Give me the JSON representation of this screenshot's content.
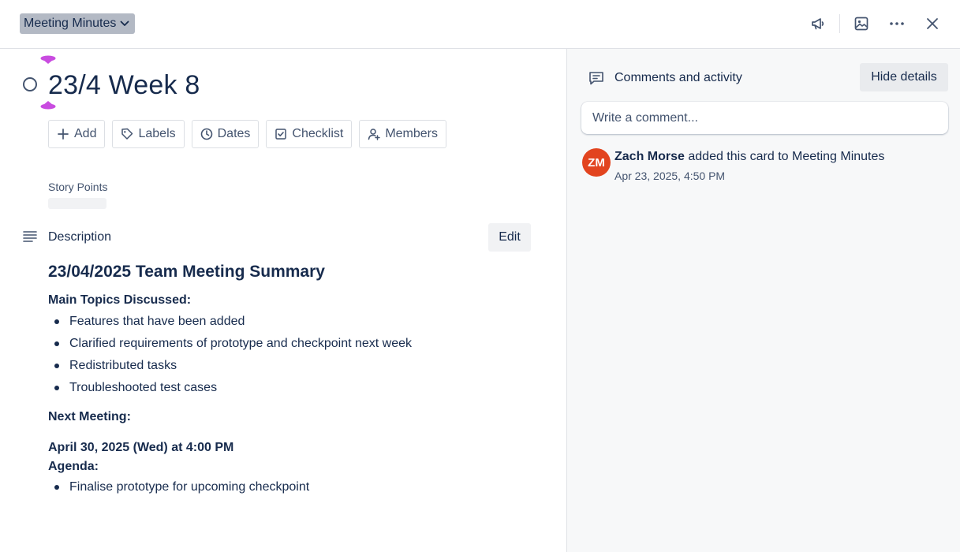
{
  "header": {
    "list_name": "Meeting Minutes",
    "icons": [
      "megaphone-icon",
      "cover-image-icon",
      "more-icon",
      "close-icon"
    ]
  },
  "card": {
    "title": "23/4 Week 8",
    "actions": [
      {
        "label": "Add",
        "icon": "plus-icon"
      },
      {
        "label": "Labels",
        "icon": "label-icon"
      },
      {
        "label": "Dates",
        "icon": "clock-icon"
      },
      {
        "label": "Checklist",
        "icon": "checklist-icon"
      },
      {
        "label": "Members",
        "icon": "add-member-icon"
      }
    ],
    "story_points_label": "Story Points",
    "description_label": "Description",
    "edit_label": "Edit"
  },
  "description": {
    "heading": "23/04/2025 Team Meeting Summary",
    "topics_label": "Main Topics Discussed:",
    "topics": [
      "Features that have been added",
      "Clarified requirements of prototype and checkpoint next week",
      "Redistributed tasks",
      "Troubleshooted test cases"
    ],
    "next_meeting_label": "Next Meeting:",
    "next_meeting_date": "April 30, 2025 (Wed) at 4:00 PM",
    "agenda_label": "Agenda:",
    "agenda": [
      "Finalise prototype for upcoming checkpoint"
    ]
  },
  "activity": {
    "title": "Comments and activity",
    "hide_details": "Hide details",
    "comment_placeholder": "Write a comment...",
    "entries": [
      {
        "initials": "ZM",
        "avatar_color": "#e2441f",
        "user": "Zach Morse",
        "action": " added this card to Meeting Minutes",
        "time": "Apr 23, 2025, 4:50 PM"
      }
    ]
  },
  "colors": {
    "text": "#172b4d",
    "subtle": "#44546f",
    "drop_indicator": "#c94ce0",
    "list_pill_bg": "#b3b9c4"
  }
}
